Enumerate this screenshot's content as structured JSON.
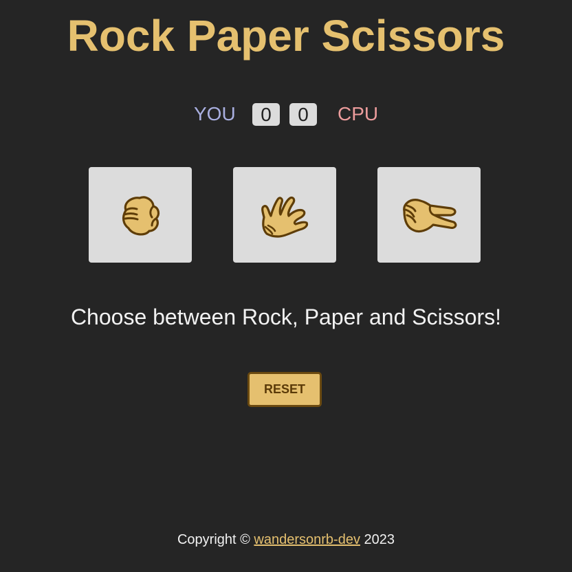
{
  "title": "Rock Paper Scissors",
  "scoreboard": {
    "you_label": "YOU",
    "cpu_label": "CPU",
    "you_score": "0",
    "cpu_score": "0"
  },
  "choices": [
    {
      "name": "rock",
      "icon": "rock-hand-icon"
    },
    {
      "name": "paper",
      "icon": "paper-hand-icon"
    },
    {
      "name": "scissors",
      "icon": "scissors-hand-icon"
    }
  ],
  "message": "Choose between Rock, Paper and Scissors!",
  "reset_label": "RESET",
  "footer": {
    "prefix": "Copyright ©",
    "link_text": "wandersonrb-dev",
    "year": "2023"
  },
  "colors": {
    "background": "#252525",
    "accent": "#e5c06f",
    "you": "#a9afe0",
    "cpu": "#ec9c9c",
    "card": "#dcdcdc"
  }
}
